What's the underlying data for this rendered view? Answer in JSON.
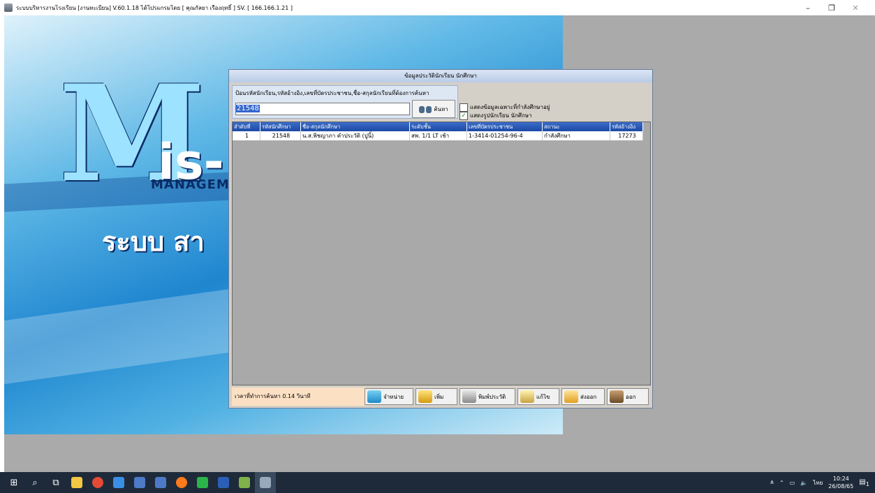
{
  "window": {
    "title": "ระบบบริหารงานโรงเรียน [งานทะเบียน] V.60.1.18 ได้โปรแกรมโดย [ คุณกัลยา เรืองฤทธิ์ ] SV. [ 166.166.1.21 ]",
    "minimize_glyph": "–",
    "maximize_glyph": "❐",
    "close_glyph": "✕"
  },
  "splash": {
    "letter": "M",
    "is_text": "is-",
    "manage_text": "MANAGEM",
    "thai_text": "ระบบ สา"
  },
  "dialog": {
    "title": "ข้อมูลประวัตินักเรียน นักศึกษา",
    "search_label": "ป้อนรหัสนักเรียน,รหัสอ้างอิง,เลขที่บัตรประชาชน,ชื่อ-สกุลนักเรียนที่ต้องการค้นหา",
    "search_value": "21548",
    "search_button": "ค้นหา",
    "options": [
      {
        "label": "แสดงข้อมูลเฉพาะที่กำลังศึกษาอยู่",
        "checked": false
      },
      {
        "label": "แสดงรูปนักเรียน นักศึกษา",
        "checked": true
      }
    ],
    "table": {
      "columns": [
        "ลำดับที่",
        "รหัสนักศึกษา",
        "ชื่อ-สกุลนักศึกษา",
        "ระดับชั้น",
        "เลขที่บัตรประชาชน",
        "สถานะ",
        "รหัสอ้างอิง"
      ],
      "rows": [
        [
          "1",
          "21548",
          "น.ส.พิชญาภา คำประวัติ (ปูนิ้)",
          "สพ. 1/1 LT เช้า",
          "1-3414-01254-96-4",
          "กำลังศึกษา",
          "17273"
        ]
      ]
    },
    "elapsed": "เวลาที่ทำการค้นหา 0.14 วินาที",
    "buttons": {
      "dispose": "จำหน่าย",
      "add": "เพิ่ม",
      "print": "พิมพ์ประวัติ",
      "edit": "แก้ไข",
      "export": "ส่งออก",
      "exit": "ออก"
    }
  },
  "taskbar": {
    "lang": "ไทย",
    "time": "10:24",
    "date": "26/08/65",
    "notif_count": "1"
  }
}
